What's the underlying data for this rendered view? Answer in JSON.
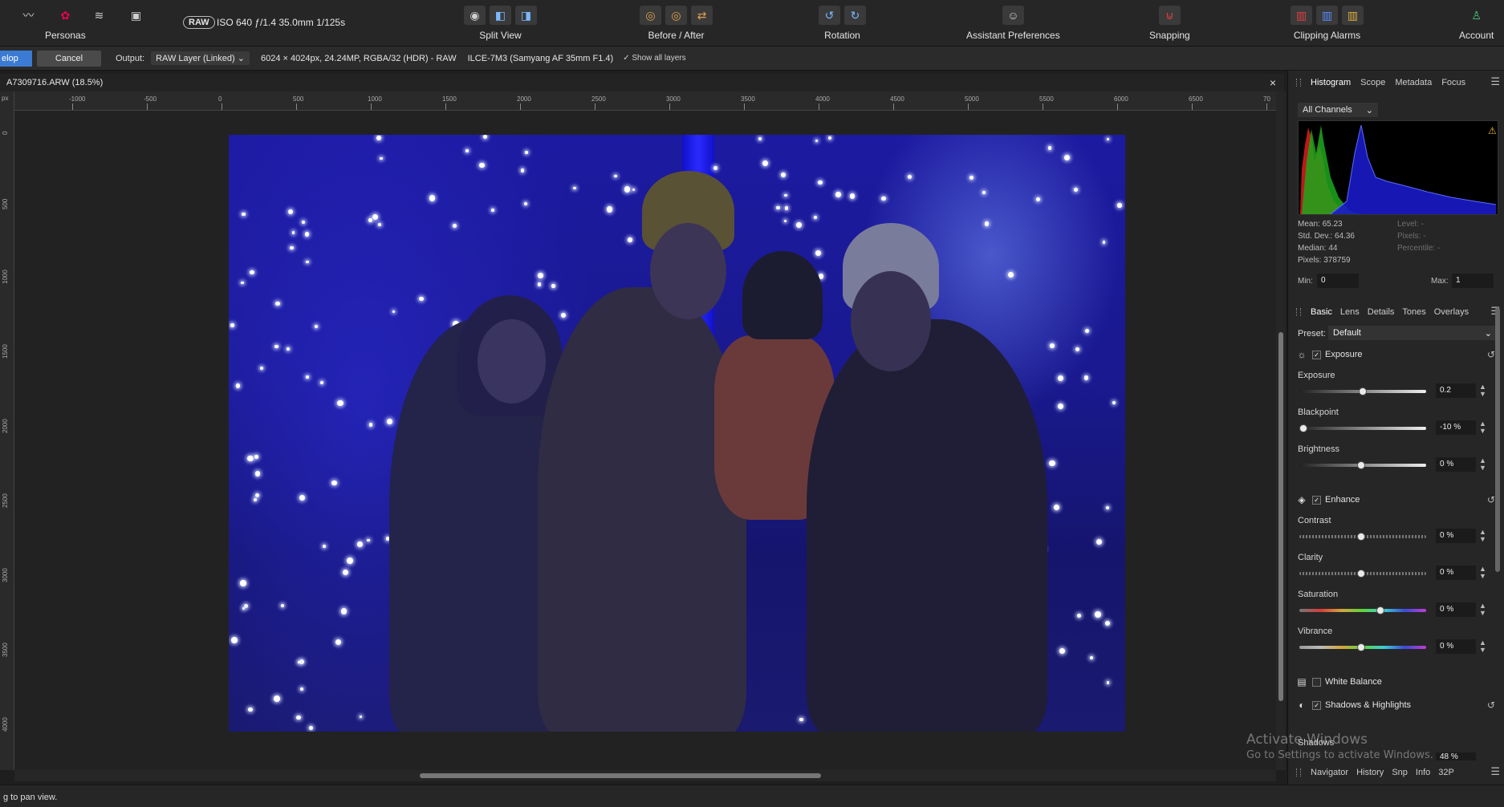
{
  "toolbar": {
    "personas_label": "Personas",
    "raw_badge": "RAW",
    "exif": "ISO 640 ƒ/1.4 35.0mm 1/125s",
    "split_view": "Split View",
    "before_after": "Before / After",
    "rotation": "Rotation",
    "assistant": "Assistant Preferences",
    "snapping": "Snapping",
    "clipping": "Clipping Alarms",
    "account": "Account"
  },
  "context": {
    "develop": "elop",
    "cancel": "Cancel",
    "output_label": "Output:",
    "output_value": "RAW Layer (Linked)",
    "dimensions": "6024 × 4024px, 24.24MP, RGBA/32 (HDR) - RAW",
    "camera": "ILCE-7M3 (Samyang AF 35mm F1.4)",
    "show_all_layers": "Show all layers"
  },
  "document": {
    "title": "A7309716.ARW (18.5%)",
    "close": "×",
    "ruler_unit": "px",
    "ruler_h": [
      "-1000",
      "-500",
      "0",
      "500",
      "1000",
      "1500",
      "2000",
      "2500",
      "3000",
      "3500",
      "4000",
      "4500",
      "5000",
      "5500",
      "6000",
      "6500",
      "70"
    ],
    "ruler_v": [
      "0",
      "500",
      "1000",
      "1500",
      "2000",
      "2500",
      "3000",
      "3500",
      "4000"
    ]
  },
  "status": {
    "text": "g to pan view."
  },
  "histogram": {
    "tabs": [
      "Histogram",
      "Scope",
      "Metadata",
      "Focus"
    ],
    "channel": "All Channels",
    "mean": "Mean: 65.23",
    "std": "Std. Dev.: 64.36",
    "median": "Median: 44",
    "pixels": "Pixels: 378759",
    "level": "Level: -",
    "pixels_r": "Pixels: -",
    "percentile": "Percentile: -",
    "min_label": "Min:",
    "min_value": "0",
    "max_label": "Max:",
    "max_value": "1"
  },
  "basic": {
    "tabs": [
      "Basic",
      "Lens",
      "Details",
      "Tones",
      "Overlays"
    ],
    "preset_label": "Preset:",
    "preset_value": "Default",
    "exposure_section": "Exposure",
    "exposure": {
      "label": "Exposure",
      "value": "0.2"
    },
    "blackpoint": {
      "label": "Blackpoint",
      "value": "-10 %"
    },
    "brightness": {
      "label": "Brightness",
      "value": "0 %"
    },
    "enhance_section": "Enhance",
    "contrast": {
      "label": "Contrast",
      "value": "0 %"
    },
    "clarity": {
      "label": "Clarity",
      "value": "0 %"
    },
    "saturation": {
      "label": "Saturation",
      "value": "0 %"
    },
    "vibrance": {
      "label": "Vibrance",
      "value": "0 %"
    },
    "white_balance": "White Balance",
    "shadows_highlights": "Shadows & Highlights",
    "shadows_partial": "Shadows",
    "shadows_partial_value": "48 %"
  },
  "navigator": {
    "tabs": [
      "Navigator",
      "History",
      "Snp",
      "Info",
      "32P"
    ]
  },
  "watermark": {
    "line1": "Activate Windows",
    "line2": "Go to Settings to activate Windows."
  },
  "colors": {
    "accent": "#3b7bd4",
    "photo_blue": "#1c1aa0"
  }
}
